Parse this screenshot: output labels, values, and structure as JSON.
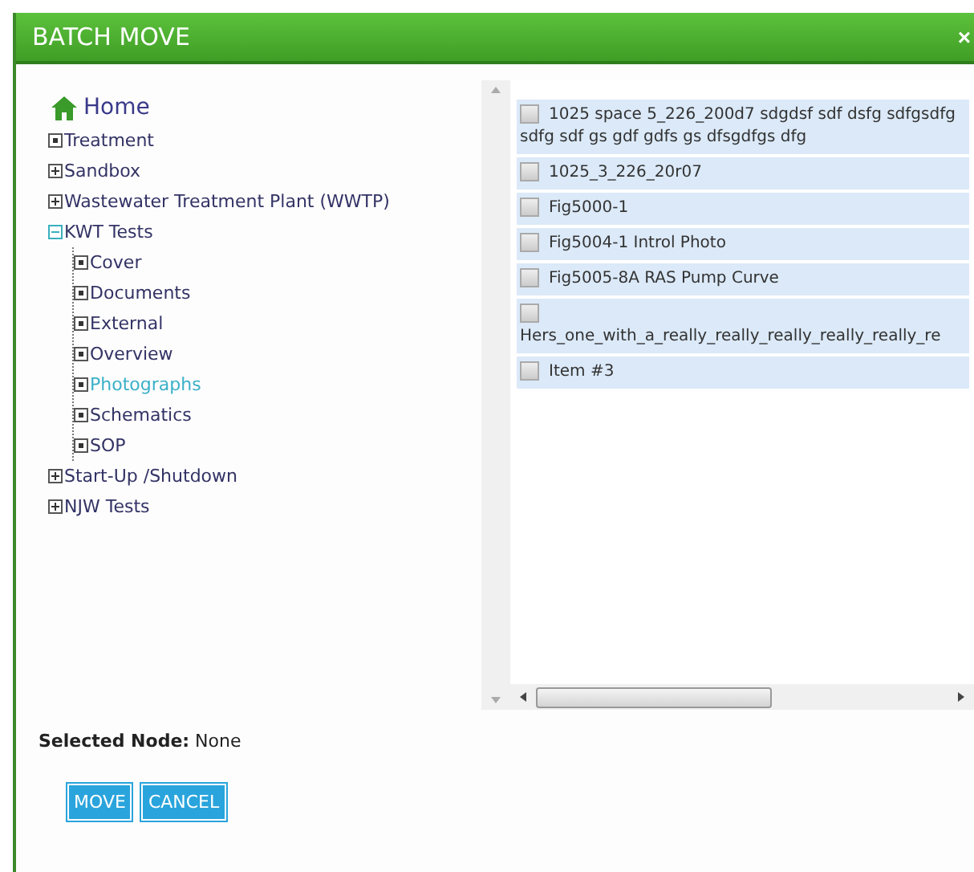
{
  "dialog": {
    "title": "BATCH MOVE",
    "close": "×"
  },
  "tree": {
    "root": "Home",
    "nodes": [
      {
        "label": "Treatment",
        "kind": "leaf",
        "highlighted": false
      },
      {
        "label": "Sandbox",
        "kind": "folder",
        "expanded": false,
        "highlighted": false
      },
      {
        "label": "Wastewater Treatment Plant (WWTP)",
        "kind": "folder",
        "expanded": false,
        "highlighted": false
      },
      {
        "label": "KWT Tests",
        "kind": "folder",
        "expanded": true,
        "highlighted": false,
        "children": [
          {
            "label": "Cover",
            "kind": "leaf",
            "highlighted": false
          },
          {
            "label": "Documents",
            "kind": "leaf",
            "highlighted": false
          },
          {
            "label": "External",
            "kind": "leaf",
            "highlighted": false
          },
          {
            "label": "Overview",
            "kind": "leaf",
            "highlighted": false
          },
          {
            "label": "Photographs",
            "kind": "leaf",
            "highlighted": true
          },
          {
            "label": "Schematics",
            "kind": "leaf",
            "highlighted": false
          },
          {
            "label": "SOP",
            "kind": "leaf",
            "highlighted": false
          }
        ]
      },
      {
        "label": "Start-Up /Shutdown",
        "kind": "folder",
        "expanded": false,
        "highlighted": false
      },
      {
        "label": "NJW Tests",
        "kind": "folder",
        "expanded": false,
        "highlighted": false
      }
    ]
  },
  "items": [
    {
      "label": "1025 space 5_226_200d7 sdgdsf sdf dsfg sdfgsdfg sdfg sdf gs gdf gdfs gs dfsgdfgs dfg",
      "checked": false
    },
    {
      "label": "1025_3_226_20r07",
      "checked": false
    },
    {
      "label": "Fig5000-1",
      "checked": false
    },
    {
      "label": "Fig5004-1 Introl Photo",
      "checked": false
    },
    {
      "label": "Fig5005-8A RAS Pump Curve",
      "checked": false
    },
    {
      "label": "Hers_one_with_a_really_really_really_really_really_re",
      "checked": false
    },
    {
      "label": "Item #3",
      "checked": false
    }
  ],
  "selected_node": {
    "label": "Selected Node:",
    "value": "None"
  },
  "buttons": [
    "MOVE",
    "CANCEL"
  ]
}
